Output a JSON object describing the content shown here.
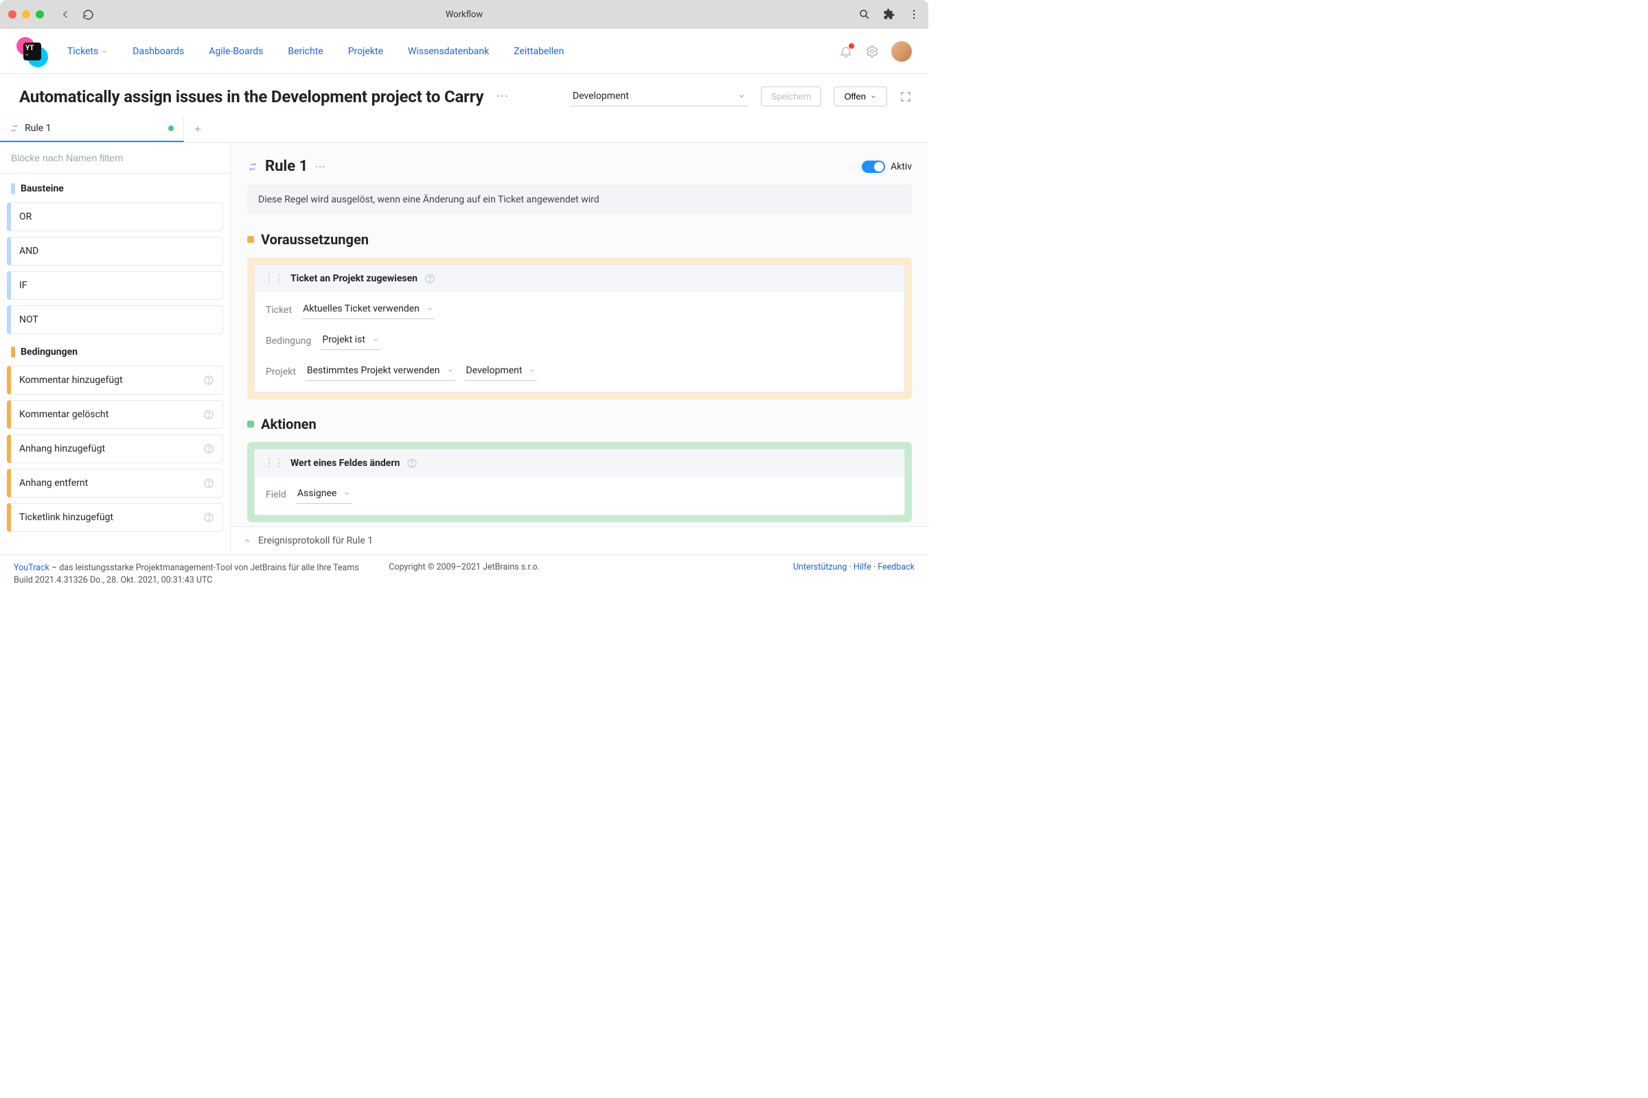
{
  "chrome": {
    "title": "Workflow"
  },
  "nav": {
    "tickets": "Tickets",
    "dashboards": "Dashboards",
    "agile": "Agile-Boards",
    "reports": "Berichte",
    "projects": "Projekte",
    "kb": "Wissensdatenbank",
    "timesheets": "Zeittabellen"
  },
  "header": {
    "title": "Automatically assign issues in the Development project to Carry",
    "project": "Development",
    "save": "Speichern",
    "status": "Offen"
  },
  "tabs": {
    "rule1": "Rule 1"
  },
  "sidebar": {
    "filter_placeholder": "Blöcke nach Namen filtern",
    "group_blocks": "Bausteine",
    "group_conditions": "Bedingungen",
    "blocks": {
      "or": "OR",
      "and": "AND",
      "if": "IF",
      "not": "NOT"
    },
    "conditions": {
      "comment_added": "Kommentar hinzugefügt",
      "comment_deleted": "Kommentar gelöscht",
      "attachment_added": "Anhang hinzugefügt",
      "attachment_removed": "Anhang entfernt",
      "ticketlink_added": "Ticketlink hinzugefügt"
    }
  },
  "rule": {
    "name": "Rule 1",
    "active_label": "Aktiv",
    "description": "Diese Regel wird ausgelöst, wenn eine Änderung auf ein Ticket angewendet wird",
    "prereq_title": "Voraussetzungen",
    "actions_title": "Aktionen",
    "prereq": {
      "card_title": "Ticket an Projekt zugewiesen",
      "ticket_label": "Ticket",
      "ticket_value": "Aktuelles Ticket verwenden",
      "condition_label": "Bedingung",
      "condition_value": "Projekt ist",
      "project_label": "Projekt",
      "project_mode": "Bestimmtes Projekt verwenden",
      "project_value": "Development"
    },
    "action": {
      "card_title": "Wert eines Feldes ändern",
      "field_label": "Field",
      "field_value": "Assignee"
    }
  },
  "eventlog": {
    "label": "Ereignisprotokoll für Rule 1"
  },
  "footer": {
    "brand": "YouTrack",
    "tagline": " – das leistungsstarke Projektmanagement-Tool von JetBrains für alle Ihre Teams",
    "build": "Build 2021.4.31326 Do., 28. Okt. 2021, 00:31:43 UTC",
    "copyright": "Copyright © 2009–2021 JetBrains s.r.o.",
    "support": "Unterstützung",
    "help": "Hilfe",
    "feedback": "Feedback"
  }
}
